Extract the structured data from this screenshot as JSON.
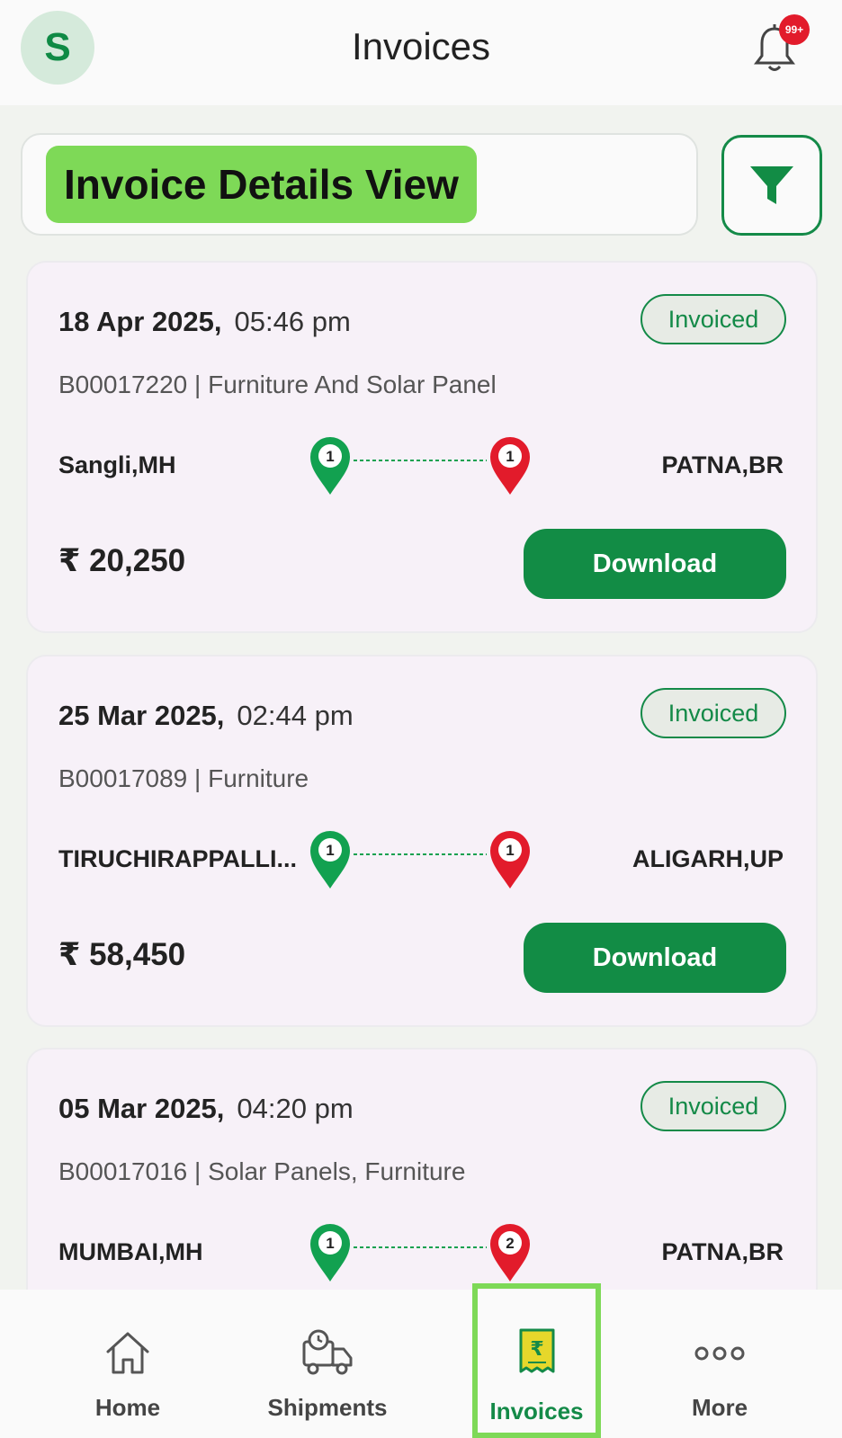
{
  "header": {
    "avatar_letter": "S",
    "title": "Invoices",
    "notification_badge": "99+"
  },
  "view": {
    "label": "Invoice Details View"
  },
  "invoices": [
    {
      "date": "18 Apr 2025,",
      "time": "05:46 pm",
      "status": "Invoiced",
      "description": "B00017220 | Furniture And Solar Panel",
      "origin": "Sangli,MH",
      "destination": "PATNA,BR",
      "pickup_count": "1",
      "drop_count": "1",
      "amount": "₹ 20,250",
      "download_label": "Download"
    },
    {
      "date": "25 Mar 2025,",
      "time": "02:44 pm",
      "status": "Invoiced",
      "description": "B00017089 | Furniture",
      "origin": "TIRUCHIRAPPALLI...",
      "destination": "ALIGARH,UP",
      "pickup_count": "1",
      "drop_count": "1",
      "amount": "₹ 58,450",
      "download_label": "Download"
    },
    {
      "date": "05 Mar 2025,",
      "time": "04:20 pm",
      "status": "Invoiced",
      "description": "B00017016 | Solar Panels, Furniture",
      "origin": "MUMBAI,MH",
      "destination": "PATNA,BR",
      "pickup_count": "1",
      "drop_count": "2"
    }
  ],
  "nav": {
    "items": [
      {
        "label": "Home",
        "icon": "home-icon"
      },
      {
        "label": "Shipments",
        "icon": "truck-clock-icon"
      },
      {
        "label": "Invoices",
        "icon": "rupee-receipt-icon"
      },
      {
        "label": "More",
        "icon": "more-dots-icon"
      }
    ]
  },
  "colors": {
    "accent": "#128c45",
    "highlight": "#7ed957",
    "drop_pin": "#e21b2b",
    "pickup_pin": "#12a150"
  }
}
